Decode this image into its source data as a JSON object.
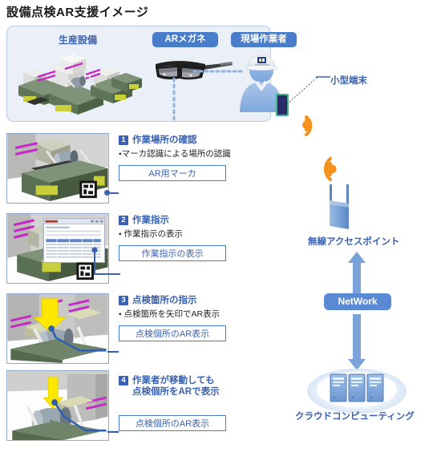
{
  "title": "設備点検AR支援イメージ",
  "equipment_panel": {
    "label": "生産設備",
    "art_name": "production-equipment-illustration"
  },
  "pills": {
    "ar_glasses": "ARメガネ",
    "field_worker": "現場作業者",
    "network": "NetWork"
  },
  "right_labels": {
    "terminal": "小型端末",
    "access_point": "無線アクセスポイント",
    "cloud": "クラウドコンピューティング"
  },
  "steps": [
    {
      "num": "1",
      "heading": "作業場所の確認",
      "heading_line2": "",
      "bullet": "・マーカ認識による場所の認識",
      "callout": "AR用マーカ"
    },
    {
      "num": "2",
      "heading": "作業指示",
      "heading_line2": "",
      "bullet": "・ 作業指示の表示",
      "callout": "作業指示の表示"
    },
    {
      "num": "3",
      "heading": "点検箇所の指示",
      "heading_line2": "",
      "bullet": "・ 点検箇所を矢印でAR表示",
      "callout": "点検個所のAR表示"
    },
    {
      "num": "4",
      "heading": "作業者が移動しても",
      "heading_line2": "点検個所をARで表示",
      "bullet": "",
      "callout": "点検個所のAR表示"
    }
  ],
  "colors": {
    "panel_bg": "#eaeff8",
    "panel_border": "#b9cbe8",
    "accent_blue": "#3a62b0",
    "pill_blue": "#4a7dc9",
    "wifi_orange": "#f6921e",
    "arrow_blue": "#7ba3d9",
    "marker_black": "#141414",
    "highlight_yellow": "#ffe800"
  }
}
